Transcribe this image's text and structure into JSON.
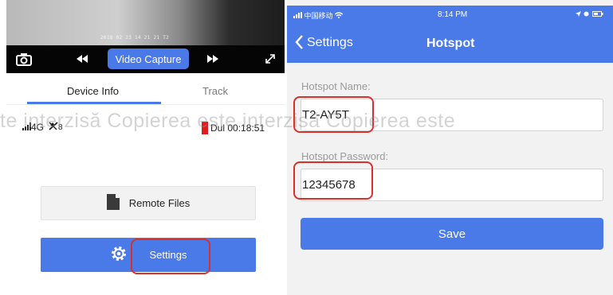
{
  "left_panel": {
    "video": {
      "osd_text": "2018 02 23  14 21 21  T2"
    },
    "controls": {
      "camera_icon": "camera-icon",
      "rewind_icon": "rewind-icon",
      "capture_label": "Video Capture",
      "forward_icon": "fast-forward-icon",
      "expand_icon": "expand-icon"
    },
    "tabs": [
      {
        "label": "Device Info",
        "active": true
      },
      {
        "label": "Track",
        "active": false
      }
    ],
    "status": {
      "network": "4G",
      "gps_count": "8",
      "battery_color": "#e01c1c",
      "duration": "Dul 00:18:51"
    },
    "buttons": {
      "remote_files": "Remote Files",
      "settings": "Settings"
    }
  },
  "right_panel": {
    "status_bar": {
      "carrier": "中国移动",
      "time": "8:14 PM"
    },
    "nav": {
      "back_label": "Settings",
      "title": "Hotspot"
    },
    "form": {
      "name_label": "Hotspot Name:",
      "name_value": "T2-AY5T",
      "password_label": "Hotspot Password:",
      "password_value": "12345678",
      "save_label": "Save"
    }
  },
  "watermark": "te interzisă Copierea este interzisă Copierea este",
  "colors": {
    "accent": "#4a79e8",
    "highlight": "#d6312b"
  }
}
